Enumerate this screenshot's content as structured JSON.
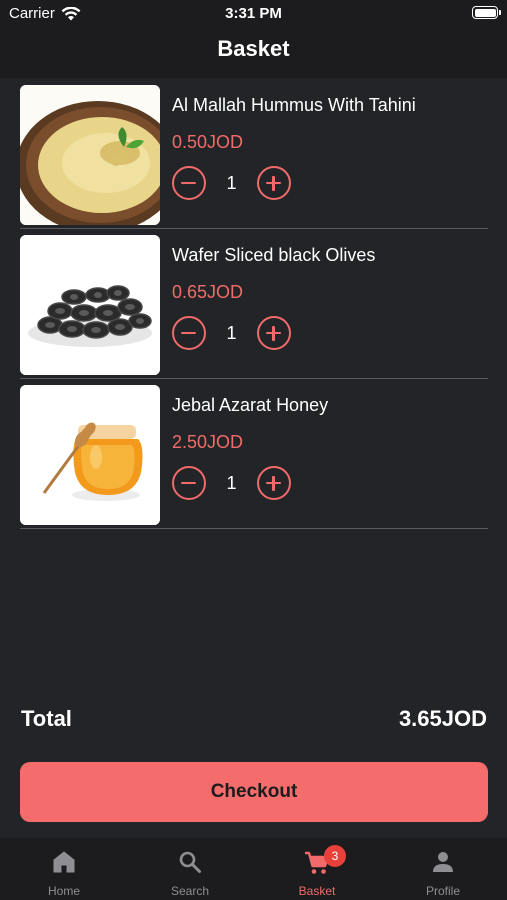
{
  "status_bar": {
    "carrier": "Carrier",
    "time": "3:31 PM"
  },
  "header": {
    "title": "Basket"
  },
  "items": [
    {
      "name": "Al Mallah Hummus With Tahini",
      "price": "0.50JOD",
      "quantity": "1",
      "image": "hummus-image"
    },
    {
      "name": "Wafer Sliced black Olives",
      "price": "0.65JOD",
      "quantity": "1",
      "image": "olives-image"
    },
    {
      "name": "Jebal Azarat Honey",
      "price": "2.50JOD",
      "quantity": "1",
      "image": "honey-image"
    }
  ],
  "summary": {
    "total_label": "Total",
    "total_value": "3.65JOD"
  },
  "checkout": {
    "label": "Checkout"
  },
  "tabbar": {
    "tabs": [
      {
        "label": "Home",
        "icon": "home-icon"
      },
      {
        "label": "Search",
        "icon": "search-icon"
      },
      {
        "label": "Basket",
        "icon": "cart-icon",
        "active": true
      },
      {
        "label": "Profile",
        "icon": "person-icon"
      }
    ],
    "basket_badge": "3"
  },
  "colors": {
    "accent": "#f26b6b",
    "background": "#232427",
    "bar": "#1c1c1e",
    "badge": "#e8403a"
  }
}
